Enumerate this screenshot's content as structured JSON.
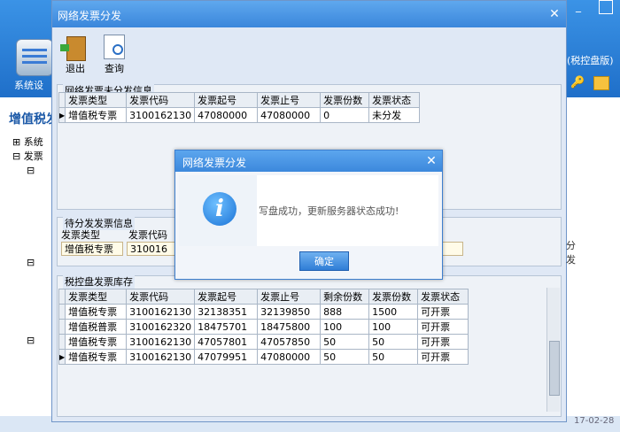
{
  "background": {
    "toolbar_label": "系统设",
    "title_right": "(税控盘版)",
    "side_title": "增值税发",
    "tree": [
      "系统",
      "发票"
    ],
    "date": "17-02-28"
  },
  "window": {
    "title": "网络发票分发",
    "toolbar": {
      "exit": "退出",
      "query": "查询"
    },
    "undistributed": {
      "title": "网络发票未分发信息",
      "headers": [
        "发票类型",
        "发票代码",
        "发票起号",
        "发票止号",
        "发票份数",
        "发票状态"
      ],
      "rows": [
        [
          "增值税专票",
          "3100162130",
          "47080000",
          "47080000",
          "0",
          "未分发"
        ]
      ]
    },
    "pending": {
      "title": "待分发发票信息",
      "type_label": "发票类型",
      "code_label": "发票代码",
      "type_value": "增值税专票",
      "code_value": "310016",
      "distribute_label": "分发"
    },
    "inventory": {
      "title": "税控盘发票库存",
      "headers": [
        "发票类型",
        "发票代码",
        "发票起号",
        "发票止号",
        "剩余份数",
        "发票份数",
        "发票状态"
      ],
      "rows": [
        [
          "增值税专票",
          "3100162130",
          "32138351",
          "32139850",
          "888",
          "1500",
          "可开票"
        ],
        [
          "增值税普票",
          "3100162320",
          "18475701",
          "18475800",
          "100",
          "100",
          "可开票"
        ],
        [
          "增值税专票",
          "3100162130",
          "47057801",
          "47057850",
          "50",
          "50",
          "可开票"
        ],
        [
          "增值税专票",
          "3100162130",
          "47079951",
          "47080000",
          "50",
          "50",
          "可开票"
        ]
      ]
    }
  },
  "dialog": {
    "title": "网络发票分发",
    "message": "写盘成功，更新服务器状态成功!",
    "ok": "确定"
  }
}
